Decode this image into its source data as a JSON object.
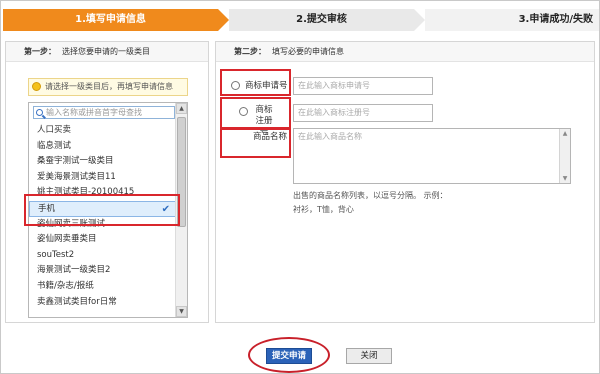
{
  "steps": {
    "step1": "1.填写申请信息",
    "step2": "2.提交审核",
    "step3": "3.申请成功/失败"
  },
  "left_panel": {
    "head_step": "第一步：",
    "head_text": "选择您要申请的一级类目",
    "hint": "请选择一级类目后，再填写申请信息",
    "search_placeholder": "输入名称或拼音首字母查找",
    "items": [
      "人口买卖",
      "临息测试",
      "桑蚕宇测试一级类目",
      "爱美海景测试类目11",
      "姚主测试类目-20100415",
      "手机",
      "姿仙网卖三账测试",
      "姿仙网卖垂类目",
      "souTest2",
      "海景测试一级类目2",
      "书籍/杂志/报纸",
      "卖鑫测试类目for日常"
    ],
    "selected_index": 5
  },
  "right_panel": {
    "head_step": "第二步：",
    "head_text": "填写必要的申请信息",
    "radio1_label": "商标申请号",
    "field1_placeholder": "在此输入商标申请号",
    "radio2_label": "商标注册号",
    "field2_placeholder": "在此输入商标注册号",
    "product_label": "商品名称",
    "product_placeholder": "在此输入商品名称",
    "note_line1": "出售的商品名称列表，以逗号分隔。 示例：",
    "note_line2": "衬衫，T恤，背心"
  },
  "buttons": {
    "submit": "提交申请",
    "close": "关闭"
  },
  "colors": {
    "active_step": "#f08a1c",
    "highlight": "#d9262c",
    "submit_bg": "#2b62b8"
  }
}
